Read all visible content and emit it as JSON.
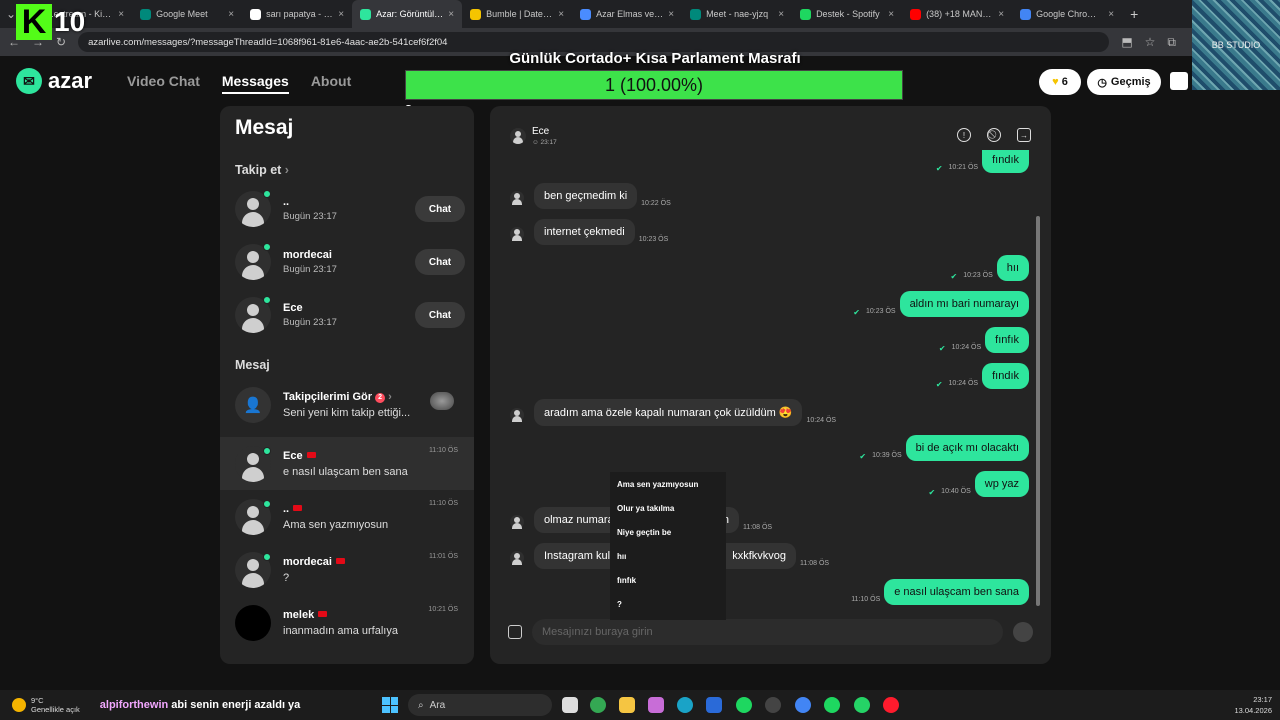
{
  "browser": {
    "tabs": [
      {
        "title": "...estream - Kick Dash",
        "color": "#53fc18"
      },
      {
        "title": "Google Meet",
        "color": "#00897b"
      },
      {
        "title": "sarı papatya - Google",
        "color": "#ffffff"
      },
      {
        "title": "Azar: Görüntülü Sohbet",
        "color": "#2ee59d",
        "active": true
      },
      {
        "title": "Bumble | Date, Chat",
        "color": "#f5c400"
      },
      {
        "title": "Azar Elmas ve Süre",
        "color": "#4a8cff"
      },
      {
        "title": "Meet - nae-yjzq",
        "color": "#00897b"
      },
      {
        "title": "Destek - Spotify",
        "color": "#1ed760"
      },
      {
        "title": "(38) +18 MANİFEST",
        "color": "#ff0000"
      },
      {
        "title": "Google Chrome Web",
        "color": "#4285f4"
      }
    ],
    "url": "azarlive.com/messages/?messageThreadId=1068f961-81e6-4aac-ae2b-541cef6f2f04"
  },
  "overlay": {
    "kick_letter": "K",
    "kick_number": "10",
    "studio": "BB STUDIO",
    "goal_title": "Günlük Cortado+ Kısa Parlament Masrafı",
    "goal_text": "1 (100.00%)",
    "goal_fraction": 1.0,
    "goal_min": "0",
    "goal_max": "1"
  },
  "header": {
    "logo": "azar",
    "nav": [
      "Video Chat",
      "Messages",
      "About"
    ],
    "gems": "6",
    "history": "Geçmiş"
  },
  "left": {
    "title": "Mesaj",
    "follow_header": "Takip et",
    "follow": [
      {
        "name": "..",
        "sub": "Bugün 23:17",
        "btn": "Chat"
      },
      {
        "name": "mordecai",
        "sub": "Bugün 23:17",
        "btn": "Chat"
      },
      {
        "name": "Ece",
        "sub": "Bugün 23:17",
        "btn": "Chat"
      }
    ],
    "messages_header": "Mesaj",
    "followers": {
      "title": "Takipçilerimi Gör",
      "badge": "2",
      "sub": "Seni yeni kim takip ettiği..."
    },
    "convs": [
      {
        "name": "Ece",
        "msg": "e nasıl ulaşcam ben sana",
        "time": "11:10 ÖS"
      },
      {
        "name": "..",
        "msg": "Ama sen yazmıyosun",
        "time": "11:10 ÖS"
      },
      {
        "name": "mordecai",
        "msg": "?",
        "time": "11:01 ÖS"
      },
      {
        "name": "melek",
        "msg": "inanmadın ama urfalıya",
        "time": "10:21 ÖS"
      }
    ]
  },
  "chat": {
    "peer": "Ece",
    "peer_time": "23:17",
    "messages": [
      {
        "dir": "out",
        "text": "fındık",
        "time": "10:21 ÖS"
      },
      {
        "dir": "in",
        "text": "ben geçmedim ki",
        "time": "10:22 ÖS"
      },
      {
        "dir": "in",
        "text": "internet çekmedi",
        "time": "10:23 ÖS"
      },
      {
        "dir": "out",
        "text": "hıı",
        "time": "10:23 ÖS"
      },
      {
        "dir": "out",
        "text": "aldın mı bari numarayı",
        "time": "10:23 ÖS"
      },
      {
        "dir": "out",
        "text": "fınfık",
        "time": "10:24 ÖS"
      },
      {
        "dir": "out",
        "text": "fındık",
        "time": "10:24 ÖS"
      },
      {
        "dir": "in",
        "text": "aradım ama özele kapalı numaran çok üzüldüm 😍",
        "time": "10:24 ÖS"
      },
      {
        "dir": "out",
        "text": "bi de açık mı olacaktı",
        "time": "10:39 ÖS"
      },
      {
        "dir": "out",
        "text": "wp yaz",
        "time": "10:40 ÖS"
      },
      {
        "dir": "in",
        "text": "olmaz numara",
        "text_end": "n",
        "time": "11:08 ÖS"
      },
      {
        "dir": "in",
        "text": "Instagram kull",
        "text_end": "kxkfkvkvog",
        "time": "11:08 ÖS"
      },
      {
        "dir": "out",
        "text": "e nasıl ulaşcam ben sana",
        "time": "11:10 ÖS"
      }
    ],
    "placeholder": "Mesajınızı buraya girin",
    "suggestions": [
      "Ama sen yazmıyosun",
      "Olur ya takılma",
      "Niye geçtin be",
      "hıı",
      "fınfık",
      "?"
    ]
  },
  "taskbar": {
    "temp": "9°C",
    "weather": "Genellikle açık",
    "ticker_user": "alpiforthewin",
    "ticker_msg": "abi senin enerji azaldı ya",
    "search": "Ara",
    "time": "23:17",
    "date": "13.04.2026"
  }
}
